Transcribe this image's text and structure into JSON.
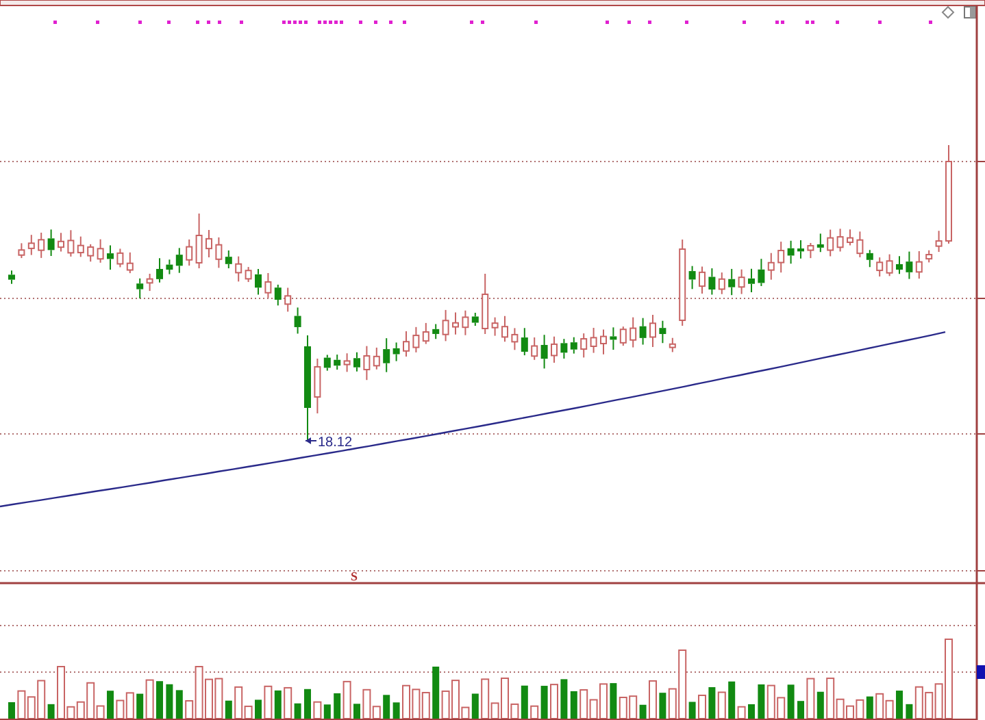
{
  "price_panel": {
    "low_label": "18.12"
  },
  "volume_panel": {
    "marker": "S"
  }
}
